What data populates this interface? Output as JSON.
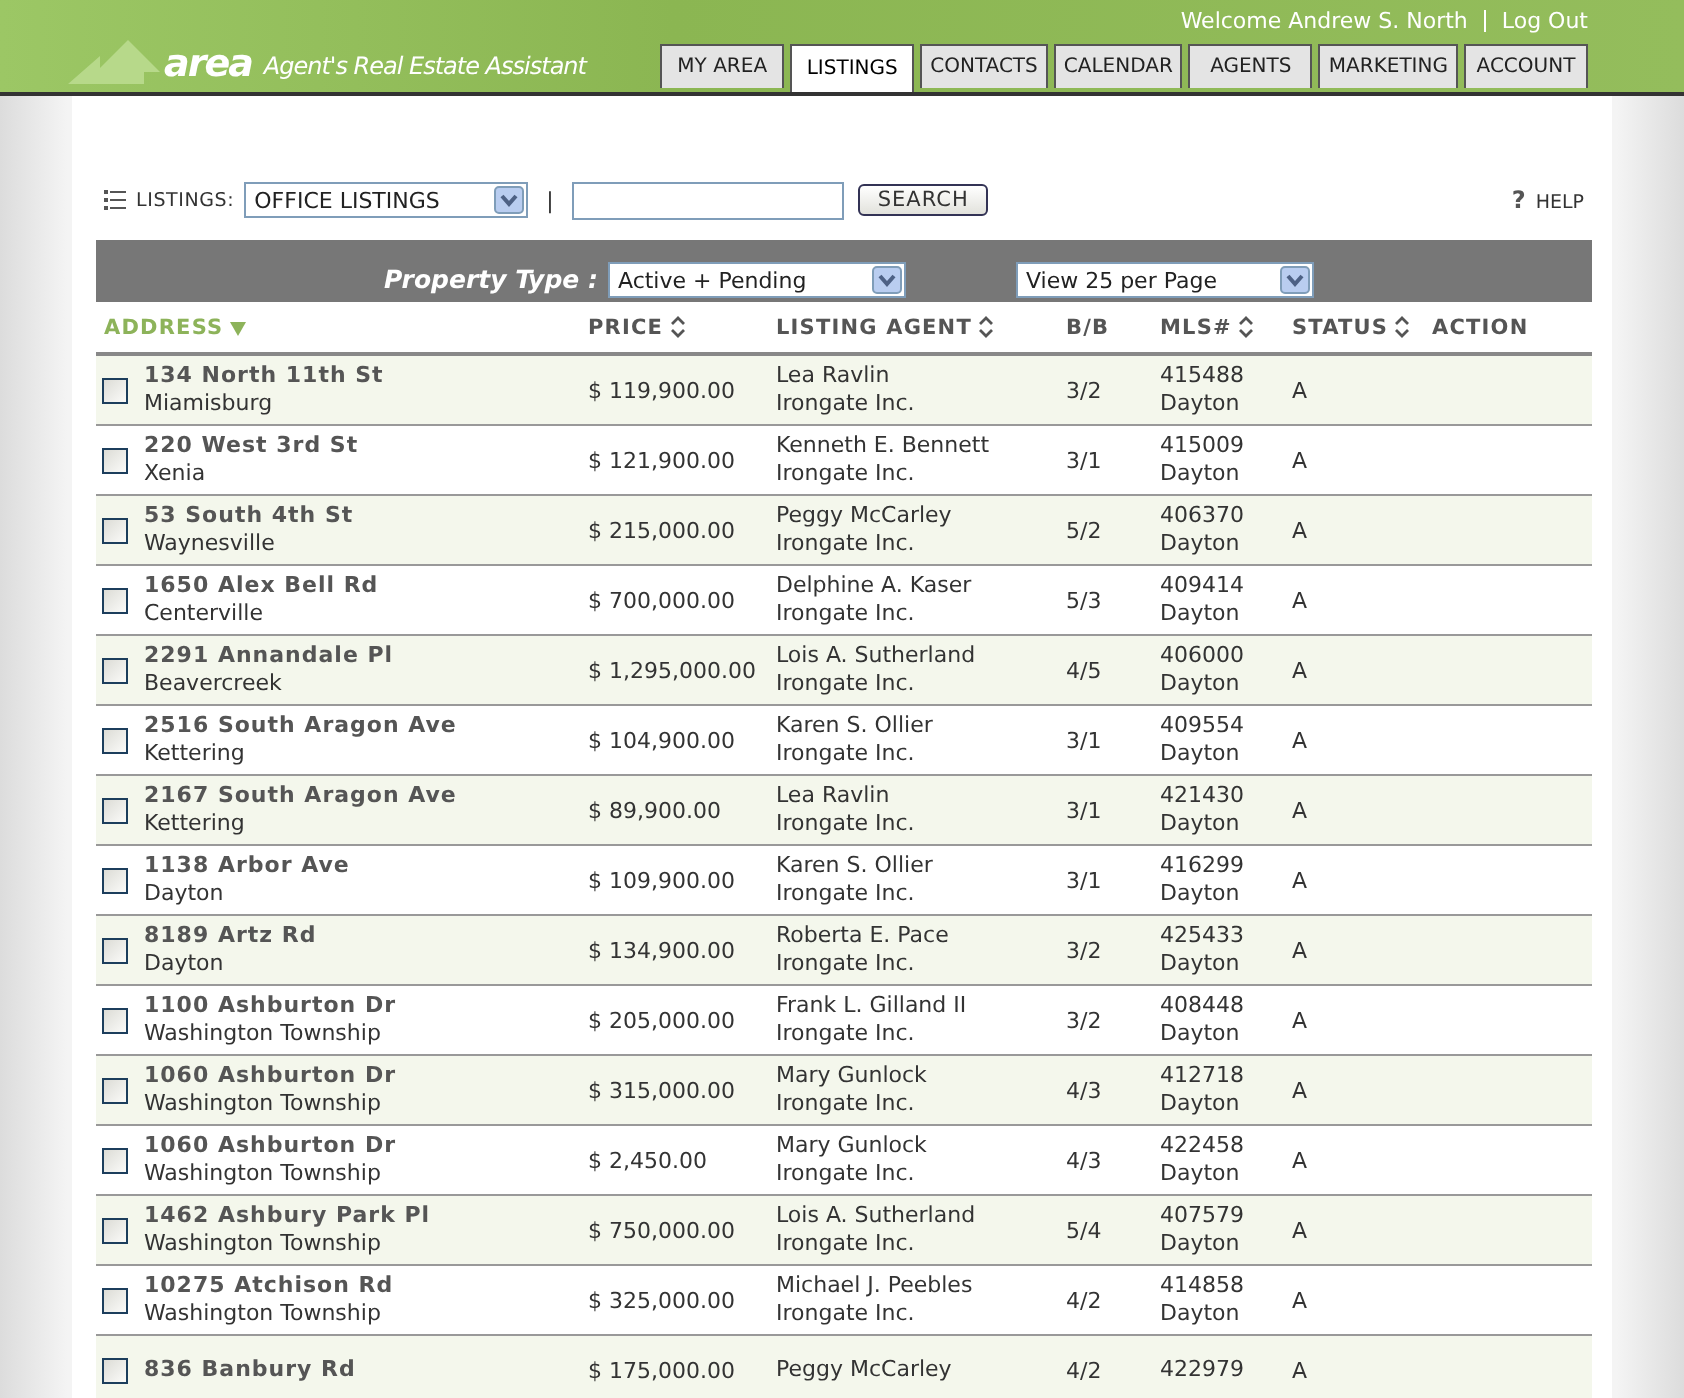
{
  "header": {
    "logo": "area",
    "tagline": "Agent's Real Estate Assistant",
    "welcome": "Welcome Andrew S. North",
    "logout": "Log Out",
    "tabs": [
      {
        "label": "MY AREA",
        "selected": false
      },
      {
        "label": "LISTINGS",
        "selected": true
      },
      {
        "label": "CONTACTS",
        "selected": false
      },
      {
        "label": "CALENDAR",
        "selected": false
      },
      {
        "label": "AGENTS",
        "selected": false
      },
      {
        "label": "MARKETING",
        "selected": false
      },
      {
        "label": "ACCOUNT",
        "selected": false
      }
    ]
  },
  "toolbar": {
    "label": "LISTINGS:",
    "listings_select": "OFFICE LISTINGS",
    "separator": "|",
    "search_button": "SEARCH",
    "help_mark": "?",
    "help": "HELP"
  },
  "filter_bar": {
    "label": "Property Type :",
    "property_type": "Active + Pending",
    "page_size": "View 25 per Page"
  },
  "table": {
    "columns": [
      {
        "label": "ADDRESS",
        "sortable": true,
        "sorted": true
      },
      {
        "label": "PRICE",
        "sortable": true,
        "sorted": false
      },
      {
        "label": "LISTING AGENT",
        "sortable": true,
        "sorted": false
      },
      {
        "label": "B/B",
        "sortable": false,
        "sorted": false
      },
      {
        "label": "MLS#",
        "sortable": true,
        "sorted": false
      },
      {
        "label": "STATUS",
        "sortable": true,
        "sorted": false
      },
      {
        "label": "ACTION",
        "sortable": false,
        "sorted": false
      }
    ],
    "rows": [
      {
        "checked": false,
        "address": "134 North 11th St",
        "city": "Miamisburg",
        "price": "$ 119,900.00",
        "agent": "Lea Ravlin",
        "office": "Irongate Inc.",
        "beds_baths": "3/2",
        "mls": "415488",
        "mls_area": "Dayton",
        "status": "A"
      },
      {
        "checked": false,
        "address": "220 West 3rd St",
        "city": "Xenia",
        "price": "$ 121,900.00",
        "agent": "Kenneth E. Bennett",
        "office": "Irongate Inc.",
        "beds_baths": "3/1",
        "mls": "415009",
        "mls_area": "Dayton",
        "status": "A"
      },
      {
        "checked": false,
        "address": "53 South 4th St",
        "city": "Waynesville",
        "price": "$ 215,000.00",
        "agent": "Peggy McCarley",
        "office": "Irongate Inc.",
        "beds_baths": "5/2",
        "mls": "406370",
        "mls_area": "Dayton",
        "status": "A"
      },
      {
        "checked": false,
        "address": "1650 Alex Bell Rd",
        "city": "Centerville",
        "price": "$ 700,000.00",
        "agent": "Delphine A. Kaser",
        "office": "Irongate Inc.",
        "beds_baths": "5/3",
        "mls": "409414",
        "mls_area": "Dayton",
        "status": "A"
      },
      {
        "checked": false,
        "address": "2291 Annandale Pl",
        "city": "Beavercreek",
        "price": "$ 1,295,000.00",
        "agent": "Lois A. Sutherland",
        "office": "Irongate Inc.",
        "beds_baths": "4/5",
        "mls": "406000",
        "mls_area": "Dayton",
        "status": "A"
      },
      {
        "checked": false,
        "address": "2516 South Aragon Ave",
        "city": "Kettering",
        "price": "$ 104,900.00",
        "agent": "Karen S. Ollier",
        "office": "Irongate Inc.",
        "beds_baths": "3/1",
        "mls": "409554",
        "mls_area": "Dayton",
        "status": "A"
      },
      {
        "checked": false,
        "address": "2167 South Aragon Ave",
        "city": "Kettering",
        "price": "$ 89,900.00",
        "agent": "Lea Ravlin",
        "office": "Irongate Inc.",
        "beds_baths": "3/1",
        "mls": "421430",
        "mls_area": "Dayton",
        "status": "A"
      },
      {
        "checked": false,
        "address": "1138 Arbor Ave",
        "city": "Dayton",
        "price": "$ 109,900.00",
        "agent": "Karen S. Ollier",
        "office": "Irongate Inc.",
        "beds_baths": "3/1",
        "mls": "416299",
        "mls_area": "Dayton",
        "status": "A"
      },
      {
        "checked": false,
        "address": "8189 Artz Rd",
        "city": "Dayton",
        "price": "$ 134,900.00",
        "agent": "Roberta E. Pace",
        "office": "Irongate Inc.",
        "beds_baths": "3/2",
        "mls": "425433",
        "mls_area": "Dayton",
        "status": "A"
      },
      {
        "checked": false,
        "address": "1100 Ashburton Dr",
        "city": "Washington Township",
        "price": "$ 205,000.00",
        "agent": "Frank L. Gilland II",
        "office": "Irongate Inc.",
        "beds_baths": "3/2",
        "mls": "408448",
        "mls_area": "Dayton",
        "status": "A"
      },
      {
        "checked": false,
        "address": "1060 Ashburton Dr",
        "city": "Washington Township",
        "price": "$ 315,000.00",
        "agent": "Mary Gunlock",
        "office": "Irongate Inc.",
        "beds_baths": "4/3",
        "mls": "412718",
        "mls_area": "Dayton",
        "status": "A"
      },
      {
        "checked": false,
        "address": "1060 Ashburton Dr",
        "city": "Washington Township",
        "price": "$ 2,450.00",
        "agent": "Mary Gunlock",
        "office": "Irongate Inc.",
        "beds_baths": "4/3",
        "mls": "422458",
        "mls_area": "Dayton",
        "status": "A"
      },
      {
        "checked": false,
        "address": "1462 Ashbury Park Pl",
        "city": "Washington Township",
        "price": "$ 750,000.00",
        "agent": "Lois A. Sutherland",
        "office": "Irongate Inc.",
        "beds_baths": "5/4",
        "mls": "407579",
        "mls_area": "Dayton",
        "status": "A"
      },
      {
        "checked": false,
        "address": "10275 Atchison Rd",
        "city": "Washington Township",
        "price": "$ 325,000.00",
        "agent": "Michael J. Peebles",
        "office": "Irongate Inc.",
        "beds_baths": "4/2",
        "mls": "414858",
        "mls_area": "Dayton",
        "status": "A"
      },
      {
        "checked": false,
        "address": "836 Banbury Rd",
        "price": "$ 175,000.00",
        "agent": "Peggy McCarley",
        "beds_baths": "4/2",
        "mls": "422979",
        "status": "A"
      }
    ]
  }
}
